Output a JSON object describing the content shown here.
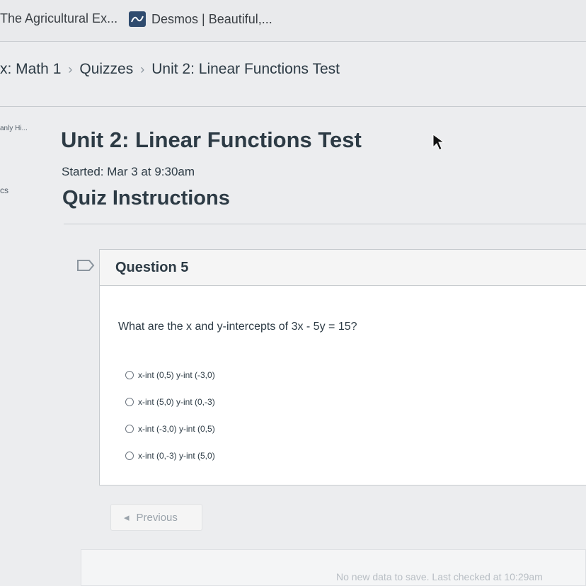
{
  "bookmarks": [
    {
      "label": "The Agricultural Ex..."
    },
    {
      "label": "Desmos | Beautiful,..."
    }
  ],
  "breadcrumb": {
    "items": [
      "x: Math 1",
      "Quizzes",
      "Unit 2: Linear Functions Test"
    ],
    "separator": "›"
  },
  "left_nav": {
    "item1": "anly Hi...",
    "item2": "cs"
  },
  "quiz": {
    "title": "Unit 2: Linear Functions Test",
    "started": "Started: Mar 3 at 9:30am",
    "instructions_heading": "Quiz Instructions"
  },
  "question": {
    "title": "Question 5",
    "text": "What are the x and y-intercepts of 3x - 5y = 15?",
    "options": [
      "x-int (0,5) y-int (-3,0)",
      "x-int (5,0) y-int (0,-3)",
      "x-int (-3,0) y-int (0,5)",
      "x-int (0,-3) y-int (5,0)"
    ]
  },
  "navigation": {
    "previous_label": "Previous",
    "previous_arrow": "◂"
  },
  "footer": {
    "status": "No new data to save. Last checked at 10:29am"
  },
  "colors": {
    "text": "#2d3b45",
    "muted": "#9aa3ab",
    "desmos": "#2f4b6e"
  },
  "icons": [
    "desmos-icon",
    "cursor-icon",
    "flag-icon",
    "radio-icon"
  ]
}
